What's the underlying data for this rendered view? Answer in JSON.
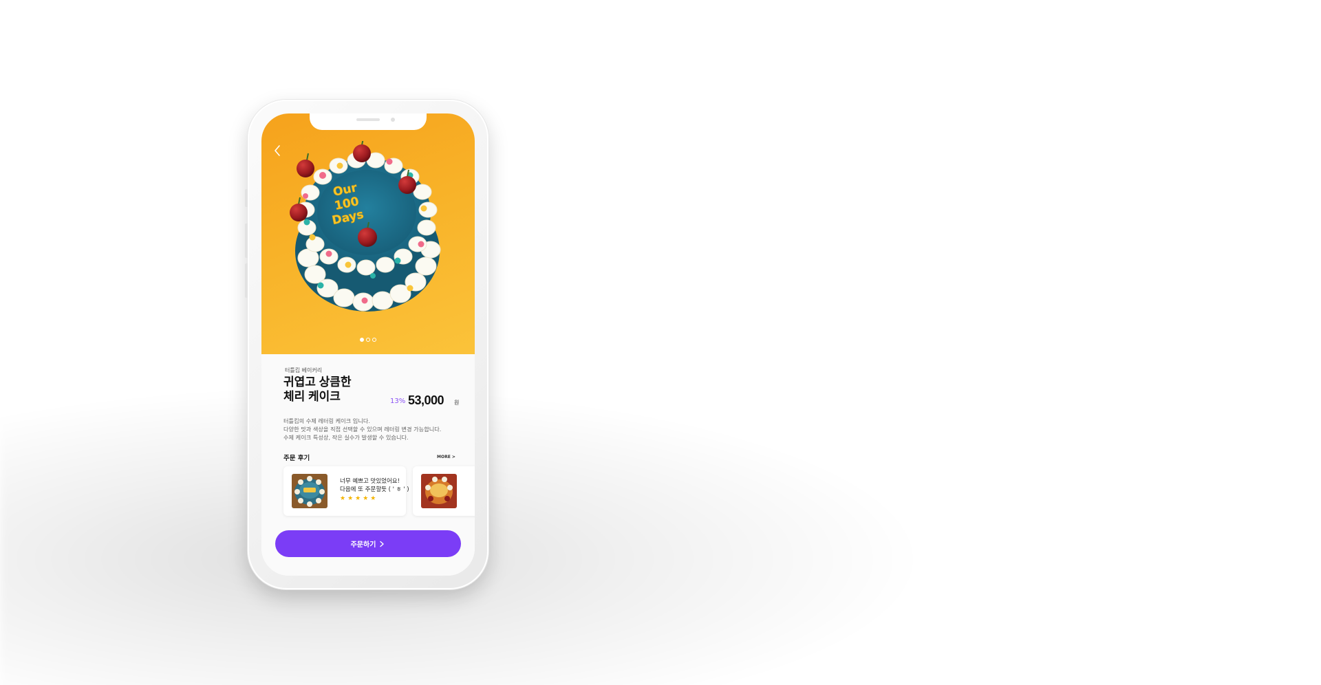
{
  "product": {
    "brand": "터틀킵 베이커리",
    "title_line1": "귀엽고 상큼한",
    "title_line2": "체리 케이크",
    "discount": "13%",
    "price": "53,000",
    "currency": "원",
    "description": [
      "터틀킵의 수제 레터링 케이크 입니다.",
      "다양한 맛과 색상을 직접 선택할 수 있으며 레터링 변경 가능합니다.",
      "수제 케이크 특성상, 작은 실수가 발생할 수 있습니다."
    ],
    "cake_lettering": [
      "Our",
      "100",
      "Days"
    ]
  },
  "carousel": {
    "total": 3,
    "active": 1
  },
  "reviews": {
    "title": "주문 후기",
    "more_label": "MORE >",
    "items": [
      {
        "line1": "너무 예쁘고 맛있었어요!",
        "line2": "다음에 또 주문할듯 ( ' ㅎ ' )",
        "stars": "★★★★★",
        "rating": 5
      }
    ]
  },
  "order_button": {
    "label": "주문하기"
  },
  "icons": {
    "back": "chevron-left-icon",
    "order_arrow": "chevron-right-icon",
    "star": "star-icon"
  },
  "colors": {
    "accent": "#7b3df6",
    "discount": "#8a52f5",
    "hero_background": "#f8b228",
    "star": "#f4b400",
    "cake_body": "#1f6f8b"
  }
}
